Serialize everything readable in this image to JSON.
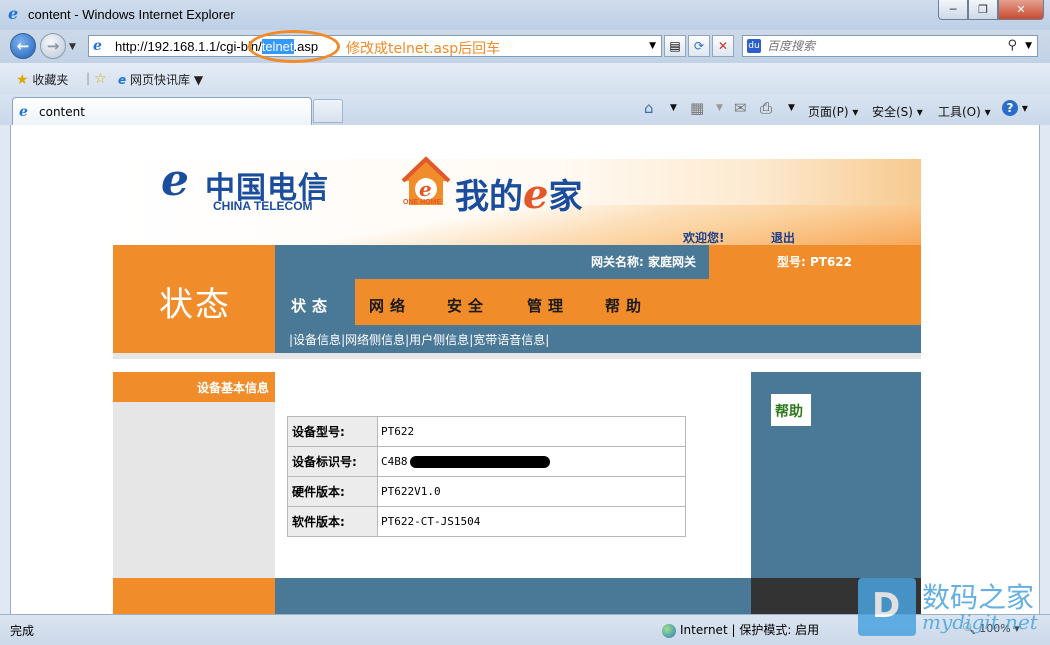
{
  "window": {
    "title": "content - Windows Internet Explorer",
    "minimize": "─",
    "restore": "❐",
    "close": "✕"
  },
  "address": {
    "url_prefix": "http://192.168.1.1/cgi-bin/",
    "url_selected": "telnet",
    "url_suffix": ".asp",
    "annotation": "修改成telnet.asp后回车"
  },
  "search": {
    "placeholder": "百度搜索",
    "engine_badge": "du"
  },
  "favorites": {
    "favorites_label": "收藏夹",
    "quicklib_label": "网页快讯库"
  },
  "tab": {
    "label": "content"
  },
  "commands": {
    "page": "页面(P)",
    "safety": "安全(S)",
    "tools": "工具(O)",
    "help_icon": "?"
  },
  "header": {
    "ct_mark": "e",
    "ct_cn": "中国电信",
    "ct_en": "CHINA TELECOM",
    "onehome_en": "ONE HOME",
    "onehome_prefix": "我的",
    "onehome_e": "e",
    "onehome_suffix": "家",
    "welcome": "欢迎您!",
    "logout": "退出"
  },
  "nav": {
    "section_title": "状态",
    "gateway_label": "网关名称: 家庭网关",
    "model_label": "型号: PT622",
    "tabs": [
      "状态",
      "网络",
      "安全",
      "管理",
      "帮助"
    ],
    "subnav_sep": "|",
    "subnav": [
      "设备信息",
      "网络侧信息",
      "用户侧信息",
      "宽带语音信息"
    ]
  },
  "left": {
    "heading": "设备基本信息"
  },
  "help": {
    "label": "帮助"
  },
  "device_info": {
    "rows": [
      {
        "key": "设备型号:",
        "value": "PT622"
      },
      {
        "key": "设备标识号:",
        "value": "C4B8"
      },
      {
        "key": "硬件版本:",
        "value": "PT622V1.0"
      },
      {
        "key": "软件版本:",
        "value": "PT622-CT-JS1504"
      }
    ]
  },
  "status": {
    "text": "完成",
    "zone": "Internet | 保护模式: 启用",
    "zoom": "100%"
  },
  "watermark": {
    "icon_letter": "D",
    "cn": "数码之家",
    "en": "mydigit.net"
  },
  "colors": {
    "orange": "#f08c2a",
    "steel_blue": "#4a7897",
    "annotation": "#f28a25",
    "telecom_blue": "#1a4d9e"
  }
}
